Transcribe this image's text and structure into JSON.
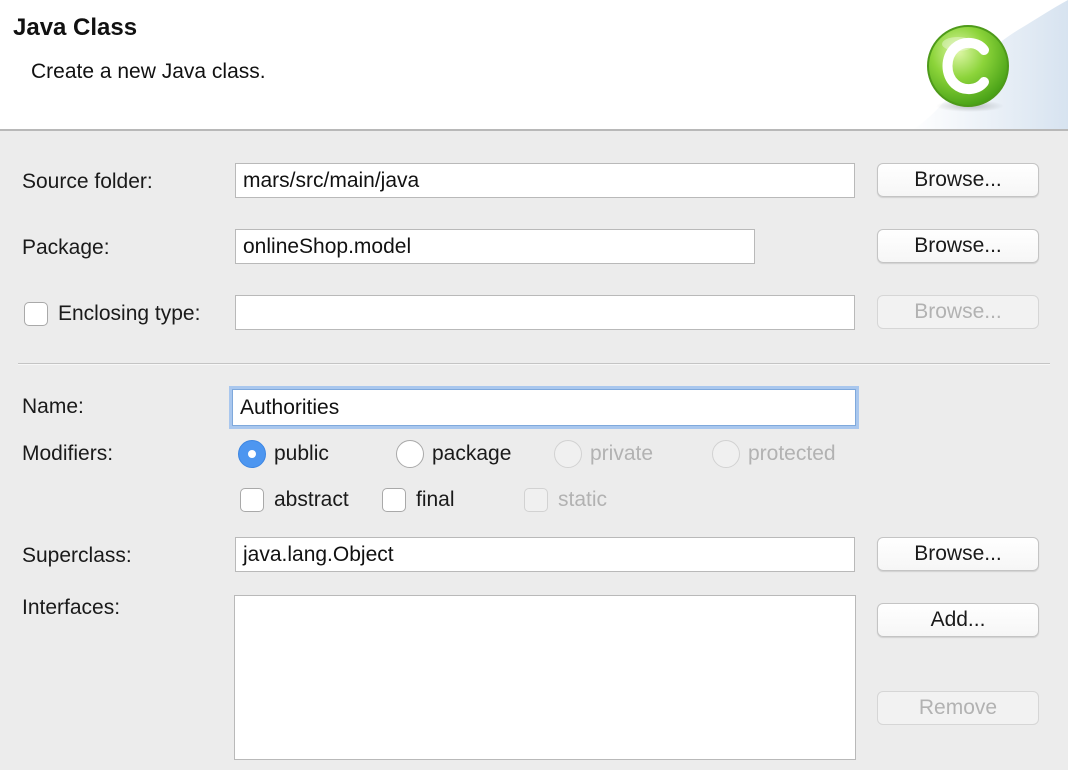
{
  "header": {
    "title": "Java Class",
    "description": "Create a new Java class."
  },
  "source_folder": {
    "label": "Source folder:",
    "value": "mars/src/main/java",
    "browse_label": "Browse..."
  },
  "package": {
    "label": "Package:",
    "value": "onlineShop.model",
    "browse_label": "Browse..."
  },
  "enclosing_type": {
    "label": "Enclosing type:",
    "checked": false,
    "value": "",
    "browse_label": "Browse..."
  },
  "name": {
    "label": "Name:",
    "value": "Authorities"
  },
  "modifiers": {
    "label": "Modifiers:",
    "access": [
      {
        "label": "public",
        "checked": true,
        "enabled": true
      },
      {
        "label": "package",
        "checked": false,
        "enabled": true
      },
      {
        "label": "private",
        "checked": false,
        "enabled": false
      },
      {
        "label": "protected",
        "checked": false,
        "enabled": false
      }
    ],
    "flags": [
      {
        "label": "abstract",
        "checked": false,
        "enabled": true
      },
      {
        "label": "final",
        "checked": false,
        "enabled": true
      },
      {
        "label": "static",
        "checked": false,
        "enabled": false
      }
    ]
  },
  "superclass": {
    "label": "Superclass:",
    "value": "java.lang.Object",
    "browse_label": "Browse..."
  },
  "interfaces": {
    "label": "Interfaces:",
    "items": [],
    "add_label": "Add...",
    "remove_label": "Remove"
  },
  "colors": {
    "accent": "#4d96f0",
    "focus_ring": "#a9c7ee",
    "icon_green": "#6cc81e"
  }
}
